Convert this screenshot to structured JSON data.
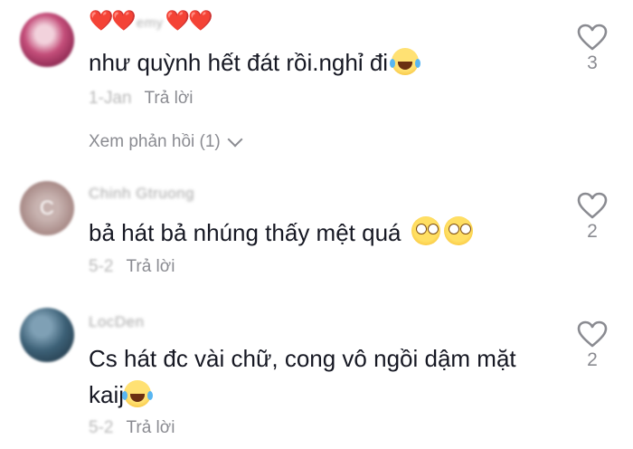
{
  "comments": [
    {
      "username_hearts_left": "❤️❤️",
      "username": "emy",
      "username_hearts_right": "❤️❤️",
      "text": "như quỳnh hết đát rồi.nghỉ đi",
      "emoji": "laugh-cry-emoji",
      "date": "1-Jan",
      "reply_label": "Trả lời",
      "view_replies_label": "Xem phản hồi (1)",
      "like_count": "3"
    },
    {
      "avatar_letter": "C",
      "username": "Chinh Gtruong",
      "text": "bả hát bả nhúng thấy mệt quá",
      "emoji": "flushed-emoji",
      "date": "5-2",
      "reply_label": "Trả lời",
      "like_count": "2"
    },
    {
      "username": "LocDen",
      "text_line1": "Cs hát đc vài chữ, cong vô ngồi dậm mặt",
      "text_line2": "kaij",
      "emoji": "laugh-cry-emoji",
      "date": "5-2",
      "reply_label": "Trả lời",
      "like_count": "2"
    }
  ],
  "colors": {
    "text": "#161823",
    "secondary": "#8a8b91",
    "heart_accent": "#e8323c"
  }
}
